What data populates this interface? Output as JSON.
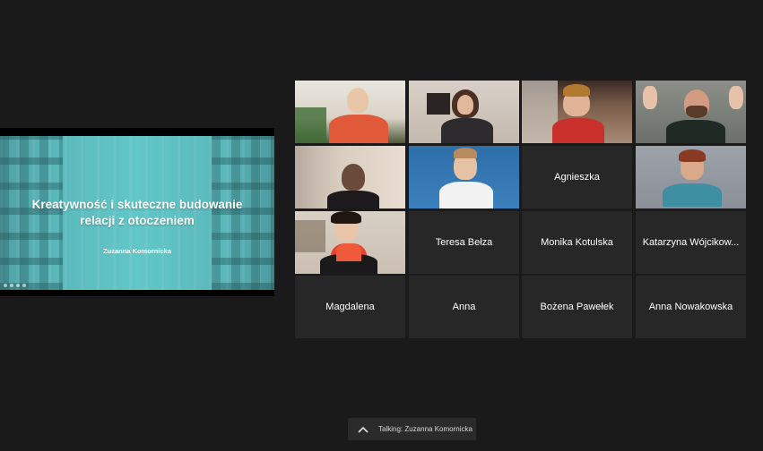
{
  "slide": {
    "title": "Kreatywność i skuteczne budowanie relacji z otoczeniem",
    "author": "Zuzanna Komornicka"
  },
  "participants": [
    {
      "label": "",
      "video": true
    },
    {
      "label": "",
      "video": true
    },
    {
      "label": "",
      "video": true
    },
    {
      "label": "",
      "video": true
    },
    {
      "label": "",
      "video": true
    },
    {
      "label": "",
      "video": true
    },
    {
      "label": "Agnieszka",
      "video": false
    },
    {
      "label": "",
      "video": true,
      "active_speaker": true
    },
    {
      "label": "",
      "video": true
    },
    {
      "label": "Teresa Bełza",
      "video": false
    },
    {
      "label": "Monika Kotulska",
      "video": false
    },
    {
      "label": "Katarzyna Wójcikow...",
      "video": false
    },
    {
      "label": "Magdalena",
      "video": false
    },
    {
      "label": "Anna",
      "video": false
    },
    {
      "label": "Bożena Pawełek",
      "video": false
    },
    {
      "label": "Anna Nowakowska",
      "video": false
    }
  ],
  "talking": {
    "text": "Talking: Zuzanna Komornicka",
    "expand_icon": "chevron-up-icon"
  },
  "colors": {
    "background": "#1a1a1a",
    "tile": "#272727",
    "active_speaker_border": "#cbd76a",
    "slide_teal": "#5ab7ba"
  }
}
